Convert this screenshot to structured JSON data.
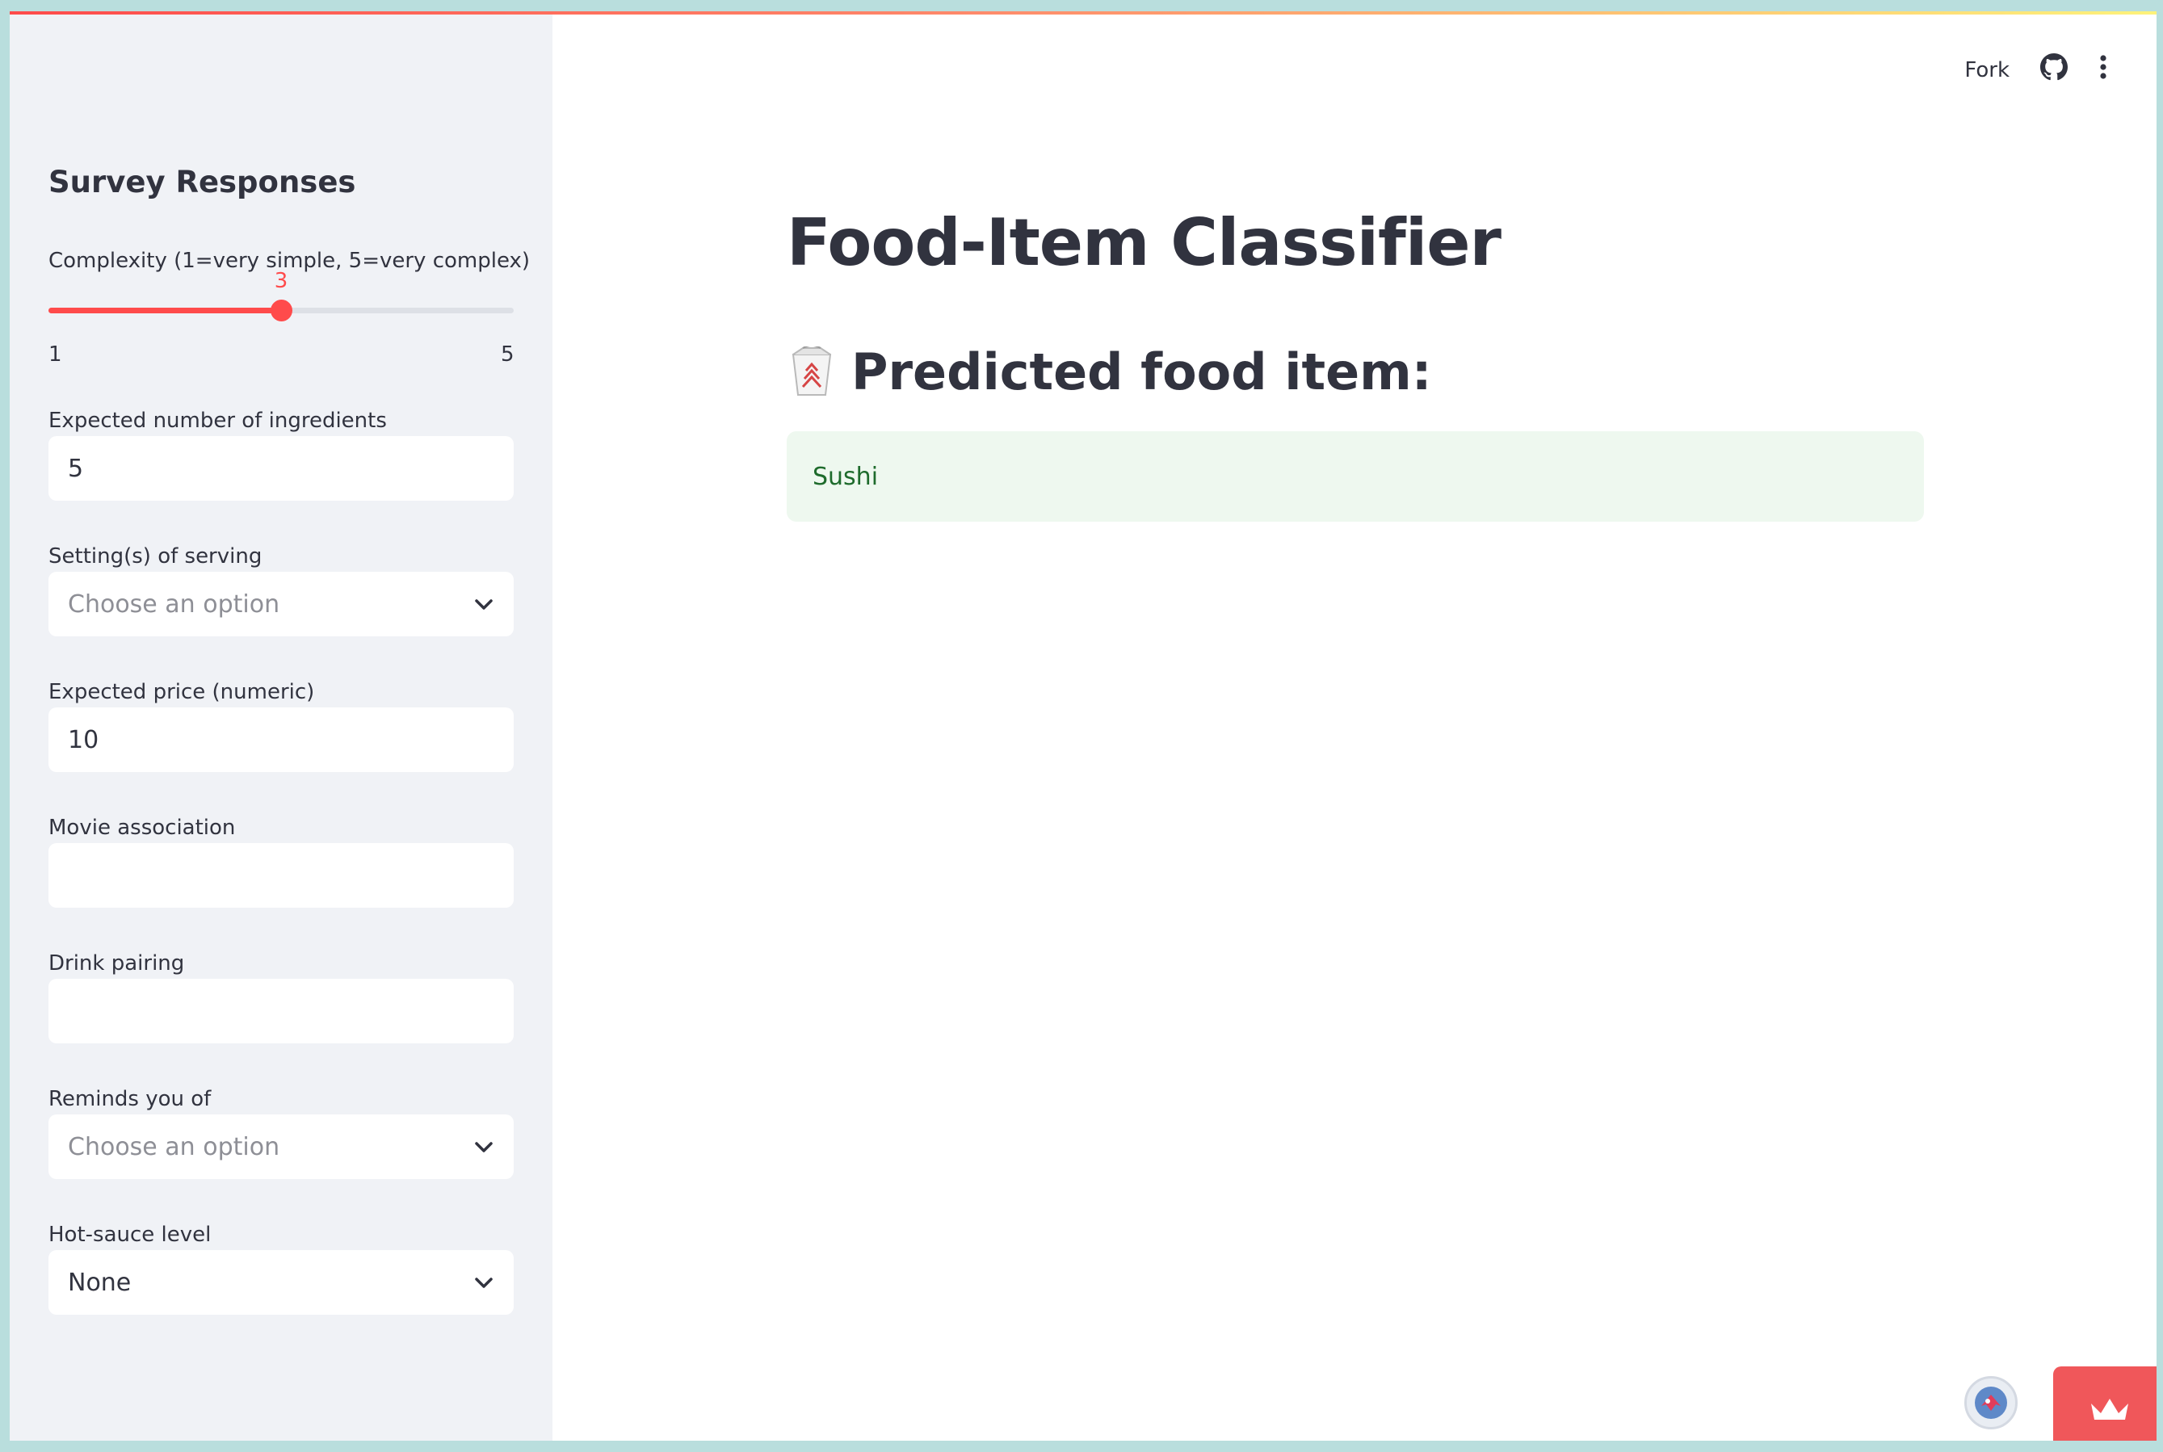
{
  "header": {
    "fork_label": "Fork",
    "github_icon": "github-icon",
    "menu_icon": "kebab-menu-icon"
  },
  "sidebar": {
    "title": "Survey Responses",
    "complexity": {
      "label": "Complexity (1=very simple, 5=very complex)",
      "min": "1",
      "max": "5",
      "value": "3"
    },
    "ingredients": {
      "label": "Expected number of ingredients",
      "value": "5"
    },
    "setting": {
      "label": "Setting(s) of serving",
      "placeholder": "Choose an option"
    },
    "price": {
      "label": "Expected price (numeric)",
      "value": "10"
    },
    "movie": {
      "label": "Movie association",
      "value": ""
    },
    "drink": {
      "label": "Drink pairing",
      "value": ""
    },
    "reminds": {
      "label": "Reminds you of",
      "placeholder": "Choose an option"
    },
    "hot_sauce": {
      "label": "Hot-sauce level",
      "value": "None"
    }
  },
  "main": {
    "title": "Food-Item Classifier",
    "subheader": "Predicted food item:",
    "subheader_icon": "takeout-box-icon",
    "prediction": "Sushi"
  },
  "colors": {
    "accent": "#ff4b4b",
    "sidebar_bg": "#f0f2f6",
    "success_bg": "#eef8ef",
    "success_text": "#1e6b2c"
  }
}
